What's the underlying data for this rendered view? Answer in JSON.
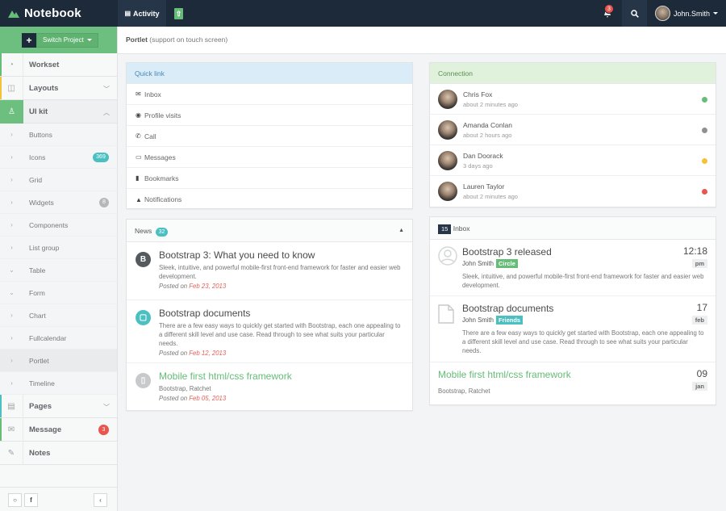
{
  "header": {
    "brand": "Notebook",
    "activity_label": "Activity",
    "upload_label": "⇧",
    "notifications_count": "3",
    "user_name": "John.Smith"
  },
  "sidebar": {
    "switch_plus": "+",
    "switch_label": "Switch Project",
    "items": [
      {
        "label": "Workset"
      },
      {
        "label": "Layouts"
      },
      {
        "label": "UI kit"
      }
    ],
    "sub_items": [
      {
        "label": "Buttons"
      },
      {
        "label": "Icons",
        "badge": "369"
      },
      {
        "label": "Grid"
      },
      {
        "label": "Widgets",
        "badge": "8"
      },
      {
        "label": "Components"
      },
      {
        "label": "List group"
      },
      {
        "label": "Table"
      },
      {
        "label": "Form"
      },
      {
        "label": "Chart"
      },
      {
        "label": "Fullcalendar"
      },
      {
        "label": "Portlet"
      },
      {
        "label": "Timeline"
      }
    ],
    "bottom_items": [
      {
        "label": "Pages"
      },
      {
        "label": "Message",
        "badge": "3"
      },
      {
        "label": "Notes"
      }
    ],
    "footer": {
      "chat_icon": "○",
      "facebook_icon": "f",
      "collapse_icon": "‹"
    }
  },
  "breadcrumb": {
    "title": "Portlet",
    "subtitle": "(support on touch screen)"
  },
  "quick_link": {
    "title": "Quick link",
    "items": [
      {
        "label": "Inbox",
        "icon": "✉"
      },
      {
        "label": "Profile visits",
        "icon": "◉"
      },
      {
        "label": "Call",
        "icon": "✆"
      },
      {
        "label": "Messages",
        "icon": "▭"
      },
      {
        "label": "Bookmarks",
        "icon": "▮"
      },
      {
        "label": "Notifications",
        "icon": "▲"
      }
    ]
  },
  "connection": {
    "title": "Connection",
    "people": [
      {
        "name": "Chris Fox",
        "time": "about 2 minutes ago",
        "status_color": "#65bd77"
      },
      {
        "name": "Amanda Conlan",
        "time": "about 2 hours ago",
        "status_color": "#909090"
      },
      {
        "name": "Dan Doorack",
        "time": "3 days ago",
        "status_color": "#f3c13a"
      },
      {
        "name": "Lauren Taylor",
        "time": "about 2 minutes ago",
        "status_color": "#e8564e"
      }
    ]
  },
  "news": {
    "title": "News",
    "count": "32",
    "items": [
      {
        "icon_text": "B",
        "icon_color": "#555a5f",
        "title": "Bootstrap 3: What you need to know",
        "desc": "Sleek, intuitive, and powerful mobile-first front-end framework for faster and easier web development.",
        "posted_prefix": "Posted on ",
        "date": "Feb 23, 2013"
      },
      {
        "icon_text": "▢",
        "icon_color": "#4cc0c1",
        "title": "Bootstrap documents",
        "desc": "There are a few easy ways to quickly get started with Bootstrap, each one appealing to a different skill level and use case. Read through to see what suits your particular needs.",
        "posted_prefix": "Posted on ",
        "date": "Feb 12, 2013"
      },
      {
        "icon_text": "▯",
        "icon_color": "#c7c9cb",
        "title": "Mobile first html/css framework",
        "desc": "Bootstrap, Ratchet",
        "posted_prefix": "Posted on ",
        "date": "Feb 05, 2013",
        "title_color": "#65bd77"
      }
    ]
  },
  "inbox": {
    "count": "15",
    "title": "Inbox",
    "items": [
      {
        "title": "Bootstrap 3 released",
        "from": "John Smith",
        "tag": "Circle",
        "tag_color": "#65bd77",
        "desc": "Sleek, intuitive, and powerful mobile-first front-end framework for faster and easier web development.",
        "time_big": "12:18",
        "time_small": "pm"
      },
      {
        "title": "Bootstrap documents",
        "from": "John Smith",
        "tag": "Friends",
        "tag_color": "#4cc0c1",
        "desc": "There are a few easy ways to quickly get started with Bootstrap, each one appealing to a different skill level and use case. Read through to see what suits your particular needs.",
        "time_big": "17",
        "time_small": "feb"
      },
      {
        "title": "Mobile first html/css framework",
        "from": "Bootstrap, Ratchet",
        "time_big": "09",
        "time_small": "jan"
      }
    ]
  },
  "colors": {
    "accent": "#65bd77",
    "header": "#1c2a3a",
    "danger": "#e8564e",
    "info": "#4cc0c1"
  }
}
